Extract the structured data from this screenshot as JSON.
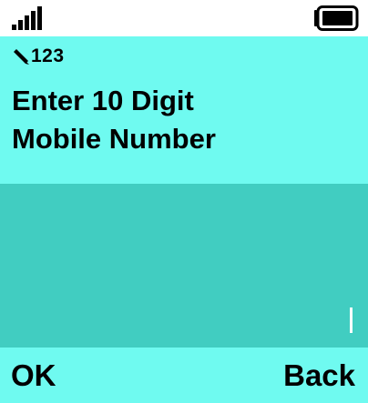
{
  "status": {
    "signal_icon": "signal-bars-icon",
    "battery_icon": "battery-full-icon"
  },
  "input_mode": {
    "icon": "pencil-icon",
    "label": "123"
  },
  "prompt": {
    "line1": "Enter 10 Digit",
    "line2": "Mobile Number"
  },
  "input": {
    "value": ""
  },
  "softkeys": {
    "left": "OK",
    "right": "Back"
  },
  "colors": {
    "background": "#6ffaf0",
    "input_background": "#41cdc1",
    "status_bar": "#ffffff",
    "text": "#000000"
  }
}
